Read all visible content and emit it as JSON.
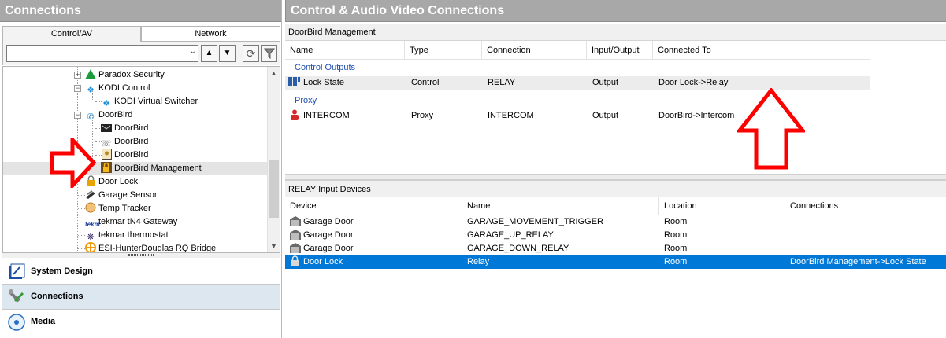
{
  "left_panel": {
    "title": "Connections",
    "tabs": [
      {
        "label": "Control/AV",
        "active": true
      },
      {
        "label": "Network",
        "active": false
      }
    ],
    "search": {
      "value": "",
      "placeholder": ""
    },
    "tree": [
      {
        "label": "Paradox Security",
        "icon": "paradox-icon"
      },
      {
        "label": "KODI Control",
        "icon": "kodi-icon"
      },
      {
        "label": "KODI Virtual Switcher",
        "icon": "kodi-icon"
      },
      {
        "label": "DoorBird",
        "icon": "doorbird-icon"
      },
      {
        "label": "DoorBird",
        "icon": "camera-icon"
      },
      {
        "label": "DoorBird",
        "icon": "intercom-icon"
      },
      {
        "label": "DoorBird",
        "icon": "doorbell-icon"
      },
      {
        "label": "DoorBird Management",
        "icon": "lock-icon",
        "selected": true
      },
      {
        "label": "Door Lock",
        "icon": "lock-icon"
      },
      {
        "label": "Garage Sensor",
        "icon": "sensor-icon"
      },
      {
        "label": "Temp Tracker",
        "icon": "temp-icon"
      },
      {
        "label": "tekmar tN4 Gateway",
        "icon": "tekmar-icon"
      },
      {
        "label": "tekmar thermostat",
        "icon": "thermostat-icon"
      },
      {
        "label": "ESI-HunterDouglas RQ Bridge",
        "icon": "bridge-icon"
      }
    ],
    "nav": [
      {
        "label": "System Design",
        "icon": "system-design-icon"
      },
      {
        "label": "Connections",
        "icon": "connections-icon",
        "active": true
      },
      {
        "label": "Media",
        "icon": "media-icon"
      }
    ]
  },
  "right_panel": {
    "title": "Control & Audio Video Connections",
    "top_section": {
      "title": "DoorBird Management",
      "columns": [
        "Name",
        "Type",
        "Connection",
        "Input/Output",
        "Connected To"
      ],
      "groups": [
        {
          "label": "Control Outputs",
          "rows": [
            {
              "name": "Lock State",
              "type": "Control",
              "connection": "RELAY",
              "io": "Output",
              "connected_to": "Door Lock->Relay"
            }
          ]
        },
        {
          "label": "Proxy",
          "rows": [
            {
              "name": "INTERCOM",
              "type": "Proxy",
              "connection": "INTERCOM",
              "io": "Output",
              "connected_to": "DoorBird->Intercom"
            }
          ]
        }
      ]
    },
    "bottom_section": {
      "title": "RELAY Input Devices",
      "columns": [
        "Device",
        "Name",
        "Location",
        "Connections"
      ],
      "rows": [
        {
          "device": "Garage Door",
          "name": "GARAGE_MOVEMENT_TRIGGER",
          "location": "Room",
          "connections": ""
        },
        {
          "device": "Garage Door",
          "name": "GARAGE_UP_RELAY",
          "location": "Room",
          "connections": ""
        },
        {
          "device": "Garage Door",
          "name": "GARAGE_DOWN_RELAY",
          "location": "Room",
          "connections": ""
        },
        {
          "device": "Door Lock",
          "name": "Relay",
          "location": "Room",
          "connections": "DoorBird Management->Lock State",
          "selected": true
        }
      ]
    }
  },
  "colors": {
    "title_bar": "#a8a8a8",
    "selection_blue": "#0078d7",
    "group_blue": "#1f4fb0",
    "annotation_red": "#ff0000"
  }
}
